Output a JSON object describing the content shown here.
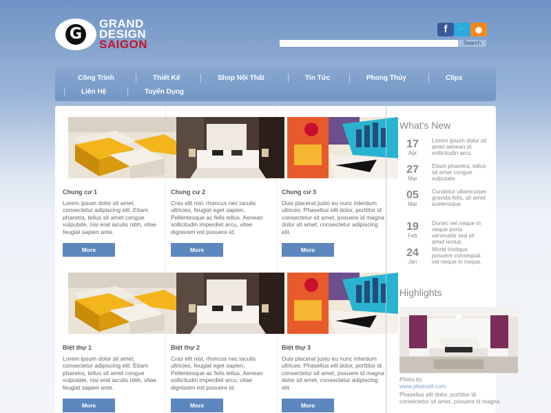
{
  "header": {
    "logo": {
      "line1": "GRAND",
      "line2": "DESIGN",
      "line3": "SAIGON",
      "letter": "G"
    },
    "social": {
      "facebook": "f",
      "twitter": "t",
      "rss": ")"
    },
    "search": {
      "placeholder": "",
      "button_label": "Search"
    }
  },
  "nav": {
    "items": [
      {
        "label": "Công Trình"
      },
      {
        "label": "Thiết Kế"
      },
      {
        "label": "Shop Nội Thất"
      },
      {
        "label": "Tin Tức"
      },
      {
        "label": "Phong Thủy"
      },
      {
        "label": "Clips"
      },
      {
        "label": "Liên Hệ"
      },
      {
        "label": "Tuyển Dụng"
      }
    ]
  },
  "cards": [
    {
      "title": "Chung cư 1",
      "text": "Lorem ipsum dolor sit amet, consectetur adipiscing elit. Etiam pharetra, tellus sit amet congue vulputate, nisi erat iaculis nibh, vitae feugiat sapien ante.",
      "button": "More",
      "image": "sofa"
    },
    {
      "title": "Chung cư 2",
      "text": "Cras elit nisl, rhoncus nec iaculis ultricies, feugiat eget sapien. Pellentesque ac felis tellus. Aenean sollicitudin imperdiet arcu, vitae dignissim est posuere id.",
      "button": "More",
      "image": "bed"
    },
    {
      "title": "Chung cư 3",
      "text": "Duis placerat justo eu nunc interdum ultrices. Phasellus elit dolor, porttitor id consectetur sit amet, posuere id magna dolor sit amet, consectetur adipiscing elit.",
      "button": "More",
      "image": "art"
    },
    {
      "title": "Biệt thự 1",
      "text": "Lorem ipsum dolor sit amet, consectetur adipiscing elit. Etiam pharetra, tellus sit amet congue vulputate, nisi erat iaculis nibh, vitae feugiat sapien ante.",
      "button": "More",
      "image": "sofa"
    },
    {
      "title": "Biệt thự 2",
      "text": "Cras elit nisl, rhoncus nec iaculis ultricies, feugiat eget sapien. Pellentesque ac felis tellus. Aenean sollicitudin imperdiet arcu, vitae dignissim est posuere id.",
      "button": "More",
      "image": "bed"
    },
    {
      "title": "Biệt thự 3",
      "text": "Duis placerat justo eu nunc interdum ultrices. Phasellus elit dolor, porttitor id consectetur sit amet, posuere id magna dolor sit amet, consectetur adipiscing elit.",
      "button": "More",
      "image": "art"
    }
  ],
  "sidebar": {
    "news_title": "What's New",
    "news": [
      {
        "day": "17",
        "month": "Apr",
        "text": "Lorem ipsum dolor sit amet aenean id sollicitudin arcu."
      },
      {
        "day": "27",
        "month": "Mar",
        "text": "Etiam pharetra, tellus sit amet congue vulputate."
      },
      {
        "day": "05",
        "month": "Mar",
        "text": "Curabitur ullamcorper gravida felis, sit amet scelerisque."
      },
      {
        "day": "19",
        "month": "Feb",
        "text": "Donec vel neque in neque porta venenatis sed sit amet lectus."
      },
      {
        "day": "24",
        "month": "Jan",
        "text": "Morbi tristique posuere consequat vel neque in neque."
      }
    ],
    "highlights_title": "Highlights",
    "photo_by": "Photo by",
    "photo_link": "www.photos8.com",
    "highlight_text": "Phasellus elit dolor, porttitor id consectetur sit amet, posuere id magna."
  }
}
